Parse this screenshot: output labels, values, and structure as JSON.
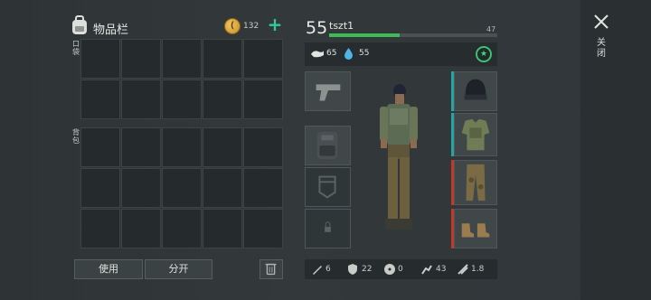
{
  "inventory": {
    "title": "物品栏",
    "coins": "132",
    "add_label": "+",
    "pocket_label": "口袋",
    "backpack_label": "背包",
    "pocket_slots": 10,
    "backpack_slots": 15
  },
  "actions": {
    "use_label": "使用",
    "split_label": "分开"
  },
  "character": {
    "level": "55",
    "name": "tszt1",
    "xp_max_label": "47",
    "xp_fraction": 0.42,
    "food": "65",
    "water": "55",
    "equipment_slots": [
      "pistol",
      "backpack",
      "pocket",
      "locked"
    ],
    "armor_slots": [
      "beanie",
      "body-armor",
      "camo-pants",
      "boots"
    ]
  },
  "bottom_stats": {
    "damage": "6",
    "armor": "22",
    "radiation": "0",
    "speed": "43",
    "weight": "1.8"
  },
  "close": {
    "label": "关闭"
  },
  "colors": {
    "accent_green": "#3fbb55",
    "teal": "#34c79a",
    "coin": "#f1c766",
    "red_marker": "#c0392b",
    "teal_marker": "#27a3a3"
  }
}
